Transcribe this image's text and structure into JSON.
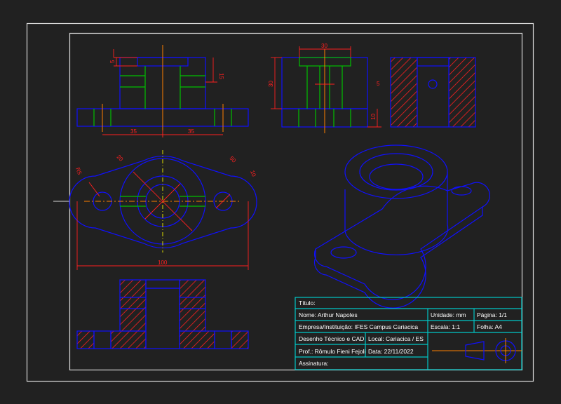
{
  "colors": {
    "background": "#212121",
    "frame": "#d8d8d8",
    "object": "#1010ff",
    "hidden": "#00c000",
    "center": "#ff8000",
    "dimension": "#ff2020",
    "hatch": "#ff2020",
    "titleblock": "#00c8c8",
    "text": "#ffffff"
  },
  "dimensions": {
    "front_height_top": "5",
    "front_height_side": "15",
    "front_left_half": "35",
    "front_right_half": "35",
    "side_width_top": "30",
    "side_height_left": "30",
    "side_height_right": "10",
    "section_depth": "5",
    "top_radius_left": "R5",
    "top_diameter_boss": "20",
    "top_diameter_outer": "50",
    "top_radius_right": "10",
    "top_overall": "100"
  },
  "title_block": {
    "title_label": "Título:",
    "name": "Nome: Arthur Napoles",
    "unit": "Unidade: mm",
    "page": "Página: 1/1",
    "company": "Empresa/Instituição: IFES Campus Cariacica",
    "scale": "Escala: 1:1",
    "sheet": "Folha: A4",
    "course": "Desenho Técnico e CAD",
    "location": "Local: Cariacica / ES",
    "professor": "Prof.: Rômulo Fieni Fejoli",
    "date": "Data: 22/11/2022",
    "signature": "Assinatura:"
  }
}
